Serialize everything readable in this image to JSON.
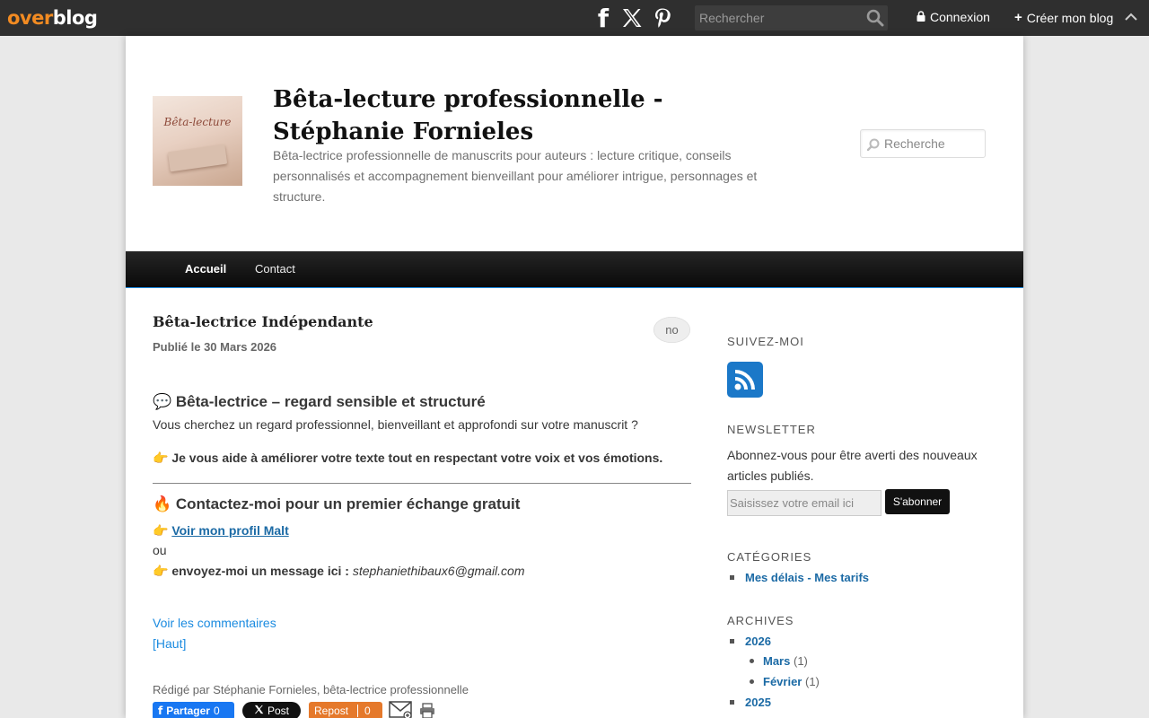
{
  "topbar": {
    "logo_over": "over",
    "logo_blog": "blog",
    "search_placeholder": "Rechercher",
    "login": "Connexion",
    "create": "Créer mon blog"
  },
  "header": {
    "thumb_text": "Bêta-lecture",
    "title": "Bêta-lecture professionnelle - Stéphanie Fornieles",
    "description": "Bêta-lectrice professionnelle de manuscrits pour auteurs : lecture critique, conseils personnalisés et accompagnement bienveillant pour améliorer intrigue, personnages et structure.",
    "search_placeholder": "Recherche"
  },
  "nav": {
    "items": [
      {
        "label": "Accueil"
      },
      {
        "label": "Contact"
      }
    ]
  },
  "post": {
    "title": "Bêta-lectrice Indépendante",
    "date": "Publié le 30 Mars 2026",
    "comment_bubble": "no",
    "heading1": "💬 Bêta-lectrice – regard sensible et structuré",
    "intro": "Vous cherchez un regard professionnel, bienveillant et approfondi sur votre manuscrit ?",
    "help": "👉 Je vous aide à améliorer votre texte tout en respectant votre voix et vos émotions.",
    "heading2": "🔥 Contactez-moi pour un premier échange gratuit",
    "malt_prefix": "👉 ",
    "malt_link": "Voir mon profil Malt",
    "or": "ou",
    "msg_prefix": "👉 envoyez-moi un message ici : ",
    "email": "stephaniethibaux6@gmail.com",
    "comments_link": "Voir les commentaires",
    "top_link": "[Haut]",
    "byline": "Rédigé par Stéphanie Fornieles, bêta-lectrice professionnelle",
    "share": {
      "fb_label": "Partager",
      "fb_count": "0",
      "x_label": "Post",
      "repost_label": "Repost",
      "repost_count": "0"
    }
  },
  "sidebar": {
    "follow_title": "SUIVEZ-MOI",
    "newsletter_title": "NEWSLETTER",
    "newsletter_text": "Abonnez-vous pour être averti des nouveaux articles publiés.",
    "email_placeholder": "Saisissez votre email ici",
    "subscribe": "S'abonner",
    "categories_title": "CATÉGORIES",
    "categories": [
      {
        "label": "Mes délais - Mes tarifs"
      }
    ],
    "archives_title": "ARCHIVES",
    "archives": [
      {
        "year": "2026",
        "months": [
          {
            "label": "Mars",
            "count": "(1)"
          },
          {
            "label": "Février",
            "count": "(1)"
          }
        ]
      },
      {
        "year": "2025"
      }
    ]
  },
  "colors": {
    "topbar": "#2f2f2f",
    "logo_orange": "#f28b22",
    "link_blue": "#1b6aa5",
    "nav_accent": "#1b8be0",
    "rss_blue": "#1b78c8",
    "repost_orange": "#e5792b",
    "fb_blue": "#1877f2"
  },
  "icons": [
    "facebook-icon",
    "x-icon",
    "pinterest-icon",
    "search-icon",
    "lock-icon",
    "plus-icon",
    "chevron-up-icon",
    "rss-icon",
    "mail-share-icon",
    "print-icon"
  ]
}
